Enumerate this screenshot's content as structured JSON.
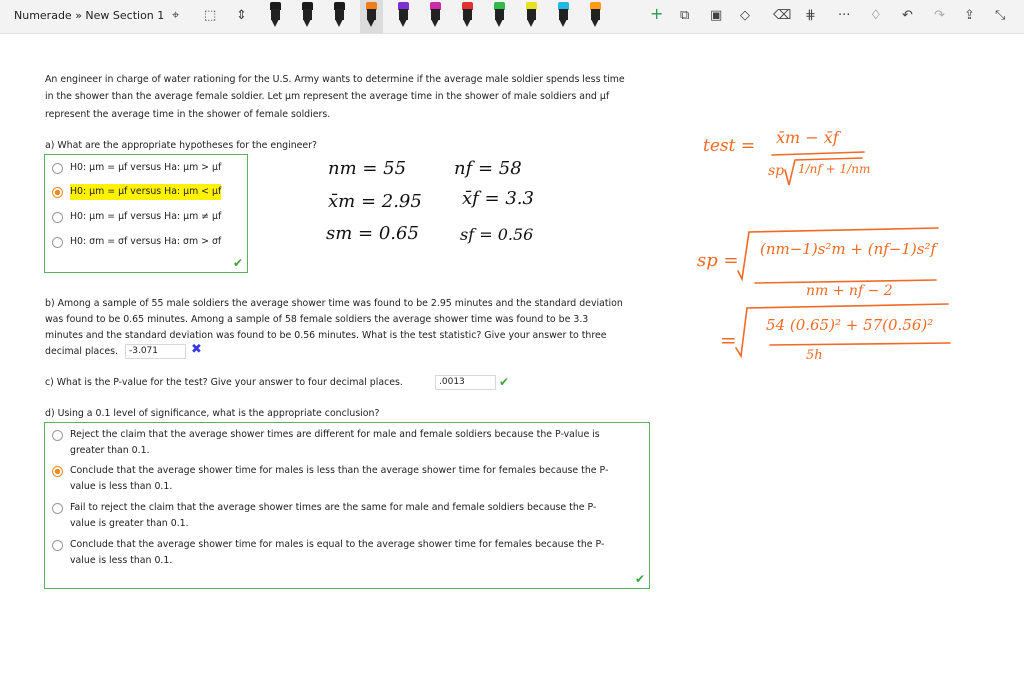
{
  "app": {
    "breadcrumb": "Numerade » New Section 1"
  },
  "toolbar": {
    "pen_colors": [
      "#1a1a1a",
      "#1a1a1a",
      "#1a1a1a",
      "#f07d1b",
      "#7a2fd1",
      "#cc2aa5",
      "#e03232",
      "#35b84a",
      "#e6e222",
      "#26b7e0",
      "#ff9c1a"
    ],
    "icons": [
      "lasso-select-icon",
      "shape-select-icon",
      "insert-space-icon",
      "add-icon",
      "copy-icon",
      "paste-icon",
      "shapes-icon",
      "eraser-icon",
      "ruler-icon",
      "more-icon",
      "notification-icon",
      "undo-icon",
      "redo-icon",
      "share-icon",
      "collapse-icon"
    ]
  },
  "problem": {
    "intro_line1": "An engineer in charge of water rationing for the U.S. Army wants to determine if the average male soldier spends less time",
    "intro_line2": "in the shower than the average female soldier. Let μm represent the average time in the shower of male soldiers and μf",
    "intro_line3": "represent the average time in the shower of female soldiers.",
    "part_a": {
      "question": "a) What are the appropriate hypotheses for the engineer?",
      "options": [
        {
          "label": "H0: μm = μf versus Ha: μm > μf",
          "selected": false
        },
        {
          "label": "H0: μm = μf versus Ha: μm < μf",
          "selected": true
        },
        {
          "label": "H0: μm = μf versus Ha: μm ≠ μf",
          "selected": false
        },
        {
          "label": "H0: σm = σf versus Ha: σm > σf",
          "selected": false
        }
      ]
    },
    "part_b": {
      "line1": "b) Among a sample of 55 male soldiers the average shower time was found to be 2.95 minutes and the standard deviation",
      "line2": "was found to be 0.65 minutes. Among a sample of 58 female soldiers the average shower time was found to be 3.3",
      "line3": "minutes and the standard deviation was found to be 0.56 minutes. What is the test statistic? Give your answer to three",
      "line4": "decimal places.",
      "answer": "-3.071"
    },
    "part_c": {
      "question": "c) What is the P-value for the test? Give your answer to four decimal places.",
      "answer": ".0013"
    },
    "part_d": {
      "question": "d) Using a 0.1 level of significance, what is the appropriate conclusion?",
      "options": [
        {
          "line1": "Reject the claim that the average shower times are different for male and female soldiers because the P-value is",
          "line2": "greater than 0.1.",
          "selected": false
        },
        {
          "line1": "Conclude that the average shower time for males is less than the average shower time for females because the P-",
          "line2": "value is less than 0.1.",
          "selected": true
        },
        {
          "line1": "Fail to reject the claim that the average shower times are the same for male and female soldiers because the P-",
          "line2": "value is greater than 0.1.",
          "selected": false
        },
        {
          "line1": "Conclude that the average shower time for males is equal to the average shower time for females because the P-",
          "line2": "value is less than 0.1.",
          "selected": false
        }
      ]
    }
  },
  "handwriting": {
    "nm": "nm = 55",
    "nf": "nf = 58",
    "xm": "x̄m = 2.95",
    "xf": "x̄f = 3.3",
    "sm": "sm = 0.65",
    "sf": "sf = 0.56",
    "test_lhs": "test =",
    "test_num": "x̄m − x̄f",
    "test_sp": "sp",
    "test_root": "1/nf + 1/nm",
    "sp_lhs": "sp =",
    "sp_num": "(nm−1)s²m + (nf−1)s²f",
    "sp_den": "nm + nf − 2",
    "eq_lhs": "=",
    "eq_num": "54 (0.65)² + 57(0.56)²",
    "eq_den": "5h"
  },
  "colors": {
    "accent_green": "#5cb25c",
    "selected_radio": "#f08a24",
    "highlight": "#fff200",
    "ink_orange": "#f06a23",
    "wrong_mark": "#3b3be0"
  }
}
